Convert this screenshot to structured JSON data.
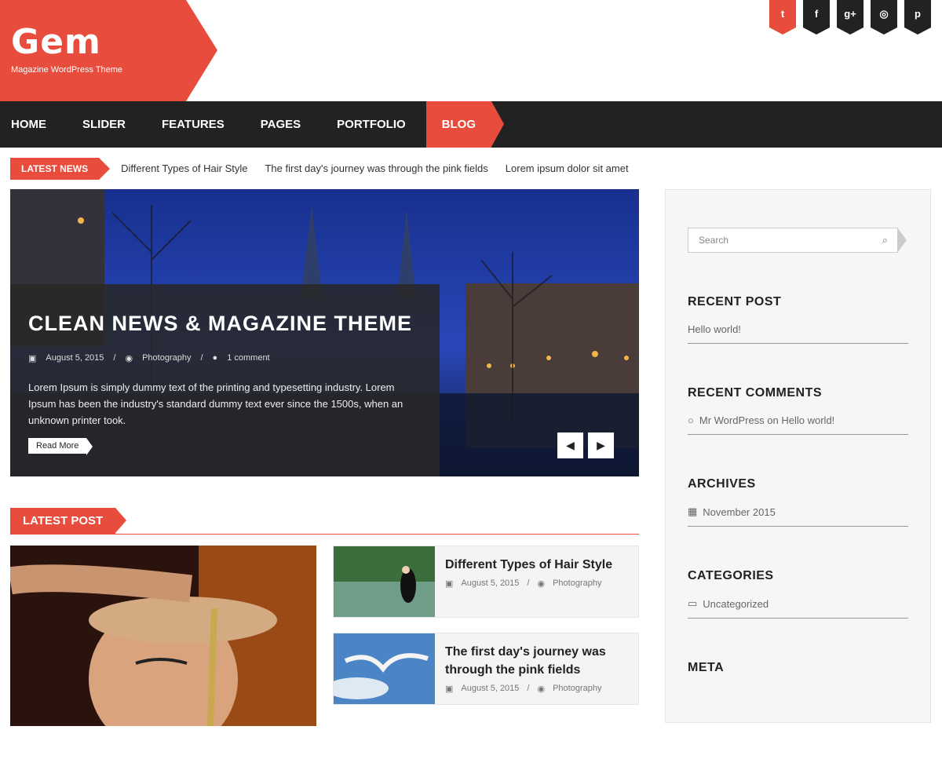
{
  "site": {
    "logo": "Gem",
    "tagline": "Magazine WordPress Theme"
  },
  "social": [
    "t",
    "f",
    "g+",
    "◎",
    "p"
  ],
  "nav": [
    "HOME",
    "SLIDER",
    "FEATURES",
    "PAGES",
    "PORTFOLIO",
    "BLOG"
  ],
  "ticker": {
    "label": "LATEST NEWS",
    "items": [
      "Different Types of Hair Style",
      "The first day's journey was through the pink fields",
      "Lorem ipsum dolor sit amet"
    ]
  },
  "slider": {
    "title": "CLEAN NEWS & MAGAZINE THEME",
    "date": "August 5, 2015",
    "category": "Photography",
    "comments": "1 comment",
    "text": "Lorem Ipsum is simply dummy text of the printing and typesetting industry. Lorem Ipsum has been the industry's standard dummy text ever since the 1500s, when an unknown printer took.",
    "read_more": "Read More"
  },
  "latest_post": {
    "label": "LATEST POST",
    "posts": [
      {
        "title": "Different Types of Hair Style",
        "date": "August 5, 2015",
        "category": "Photography"
      },
      {
        "title": "The first day's journey was through the pink fields",
        "date": "August 5, 2015",
        "category": "Photography"
      }
    ]
  },
  "sidebar": {
    "search_placeholder": "Search",
    "recent_post_title": "RECENT POST",
    "recent_post": "Hello world!",
    "recent_comments_title": "RECENT COMMENTS",
    "recent_comment": "Mr WordPress on Hello world!",
    "archives_title": "ARCHIVES",
    "archive": "November 2015",
    "categories_title": "CATEGORIES",
    "category": "Uncategorized",
    "meta_title": "META"
  }
}
